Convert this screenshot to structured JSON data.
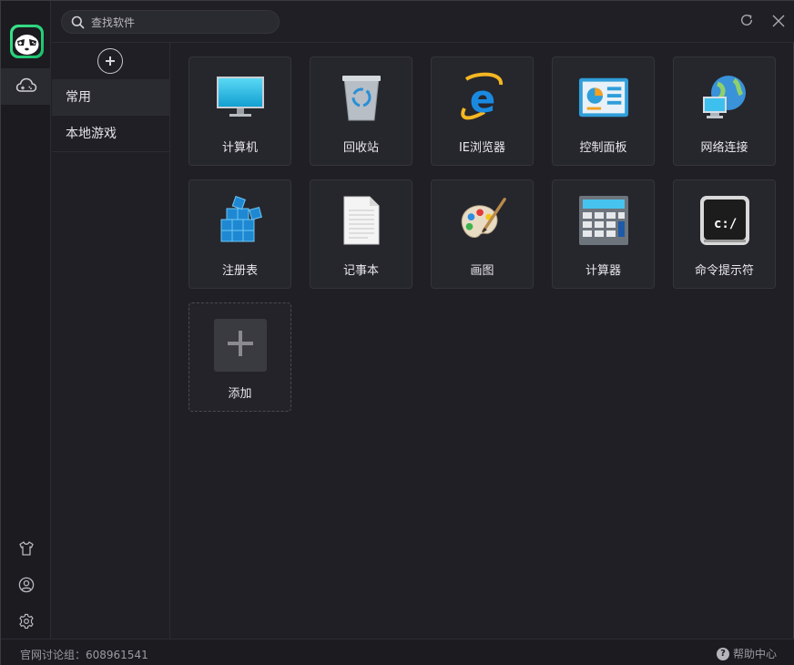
{
  "search": {
    "placeholder": "查找软件"
  },
  "categories": [
    {
      "label": "常用",
      "active": true
    },
    {
      "label": "本地游戏",
      "active": false
    }
  ],
  "apps": [
    {
      "label": "计算机",
      "icon": "monitor-icon"
    },
    {
      "label": "回收站",
      "icon": "recycle-bin-icon"
    },
    {
      "label": "IE浏览器",
      "icon": "ie-browser-icon"
    },
    {
      "label": "控制面板",
      "icon": "control-panel-icon"
    },
    {
      "label": "网络连接",
      "icon": "network-globe-icon"
    },
    {
      "label": "注册表",
      "icon": "registry-cubes-icon"
    },
    {
      "label": "记事本",
      "icon": "notepad-icon"
    },
    {
      "label": "画图",
      "icon": "paint-palette-icon"
    },
    {
      "label": "计算器",
      "icon": "calculator-icon"
    },
    {
      "label": "命令提示符",
      "icon": "command-prompt-icon"
    }
  ],
  "add_tile": {
    "label": "添加"
  },
  "cmd_glyph": "c:/",
  "status": {
    "group_text": "官网讨论组：608961541",
    "help_label": "帮助中心",
    "help_glyph": "?"
  },
  "colors": {
    "accent": "#2fd47c",
    "background": "#1f1f25",
    "tile": "#26262d"
  }
}
